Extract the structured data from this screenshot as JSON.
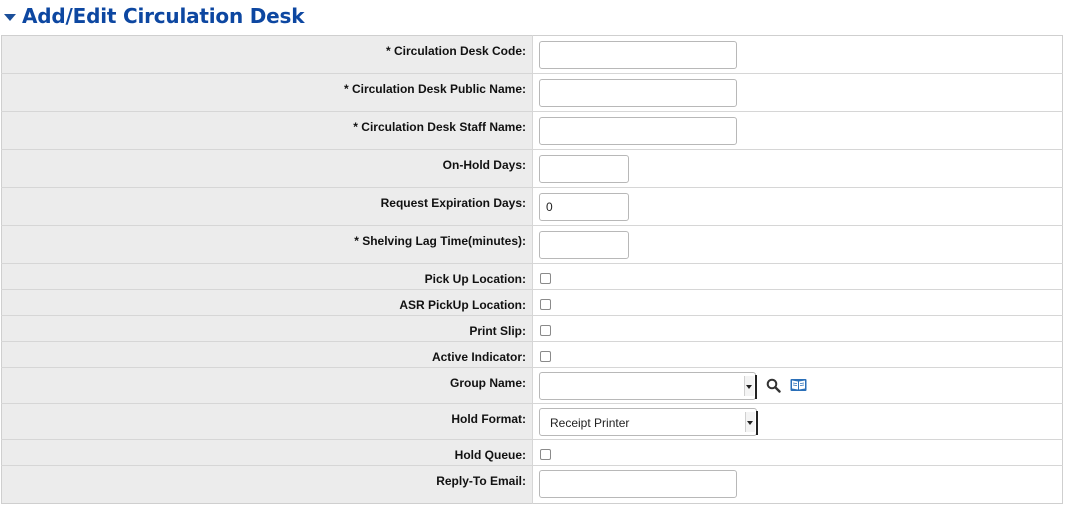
{
  "section": {
    "title": "Add/Edit Circulation Desk"
  },
  "fields": {
    "code": {
      "label": "* Circulation Desk Code:",
      "value": ""
    },
    "public_name": {
      "label": "* Circulation Desk Public Name:",
      "value": ""
    },
    "staff_name": {
      "label": "* Circulation Desk Staff Name:",
      "value": ""
    },
    "on_hold_days": {
      "label": "On-Hold Days:",
      "value": ""
    },
    "request_expiration_days": {
      "label": "Request Expiration Days:",
      "value": "0"
    },
    "shelving_lag_time": {
      "label": "* Shelving Lag Time(minutes):",
      "value": ""
    },
    "pick_up_location": {
      "label": "Pick Up Location:",
      "checked": false
    },
    "asr_pickup_location": {
      "label": "ASR PickUp Location:",
      "checked": false
    },
    "print_slip": {
      "label": "Print Slip:",
      "checked": false
    },
    "active_indicator": {
      "label": "Active Indicator:",
      "checked": false
    },
    "group_name": {
      "label": "Group Name:",
      "selected": ""
    },
    "hold_format": {
      "label": "Hold Format:",
      "selected": "Receipt Printer"
    },
    "hold_queue": {
      "label": "Hold Queue:",
      "checked": false
    },
    "reply_to_email": {
      "label": "Reply-To Email:",
      "value": ""
    }
  },
  "icons": {
    "search": "search-icon",
    "lookup": "book-lookup-icon"
  },
  "colors": {
    "title": "#0d47a1",
    "label_bg": "#ececec",
    "lookup_icon": "#2a6fb8"
  }
}
